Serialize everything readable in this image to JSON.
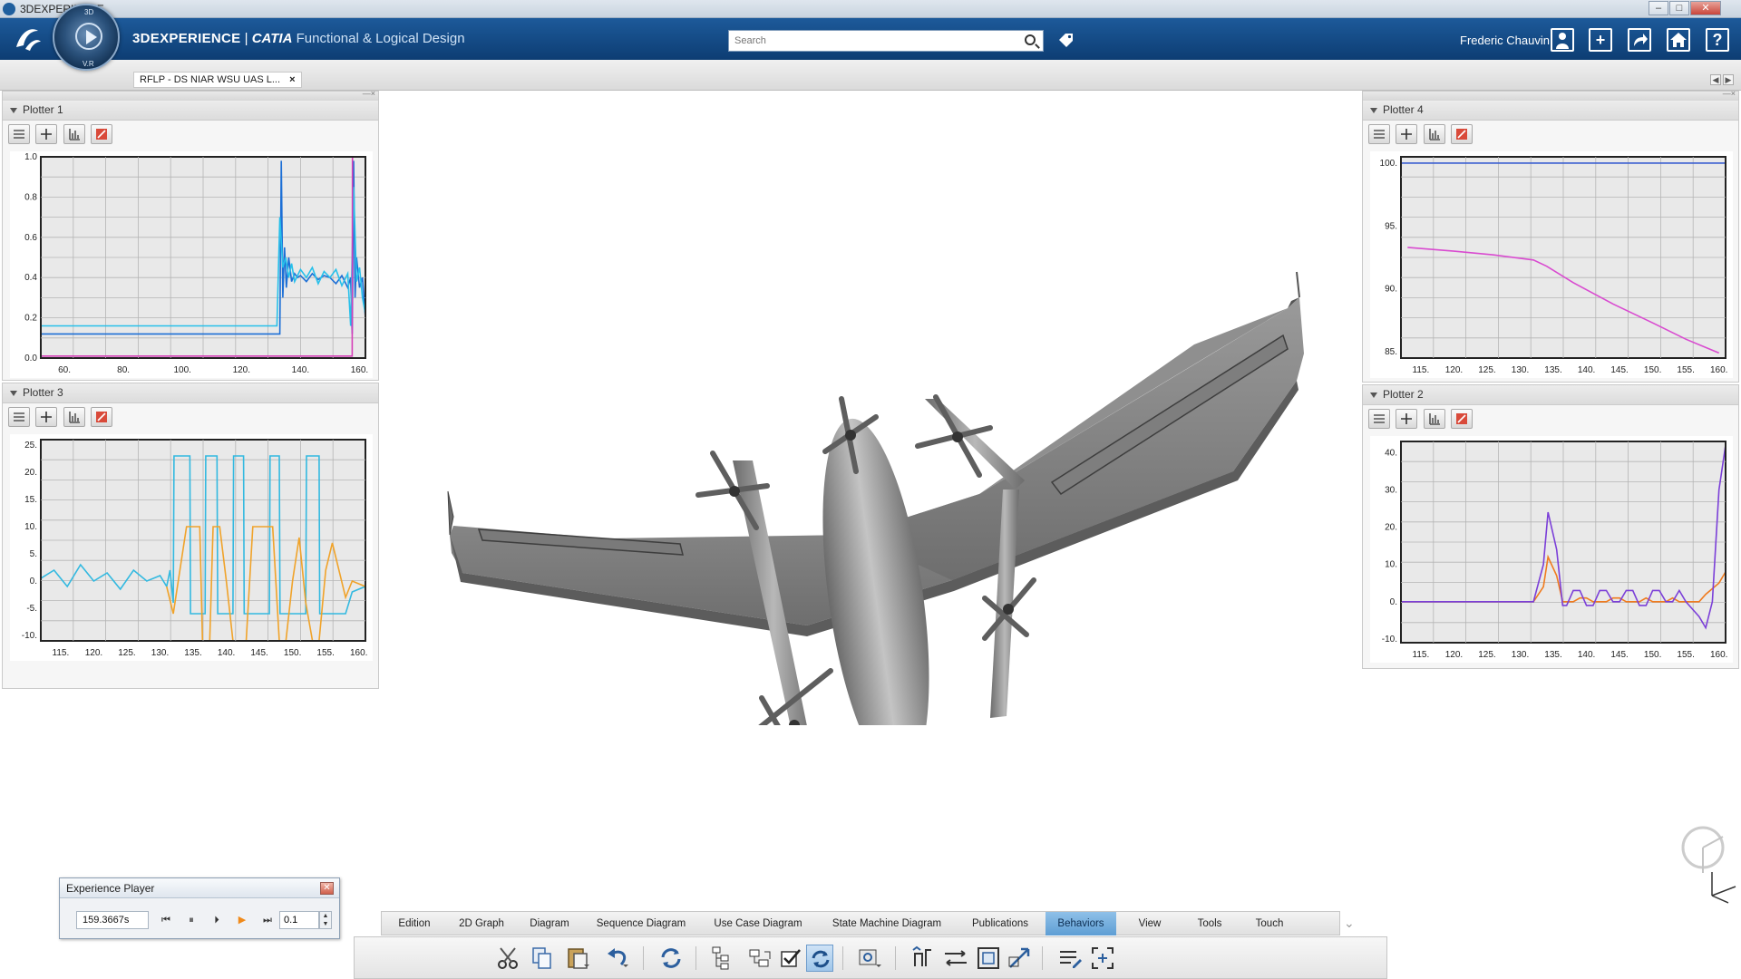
{
  "window": {
    "title": "3DEXPERIENCE"
  },
  "topbar": {
    "brand_part1": "3DEXPERIENCE",
    "brand_sep": " | ",
    "brand_part2": "CATIA",
    "brand_part3": " Functional & Logical Design",
    "search_placeholder": "Search",
    "user_name": "Frederic Chauvin",
    "compass": {
      "top_label": "3D",
      "bottom_label": "V.R"
    }
  },
  "document_tab": {
    "label": "RFLP - DS NIAR WSU UAS L...",
    "close": "×"
  },
  "plotters": {
    "p1": {
      "title": "Plotter  1",
      "chart_data": {
        "type": "line",
        "xlim": [
          52,
          162
        ],
        "ylim": [
          0,
          1.0
        ],
        "x_ticks": [
          "60.",
          "80.",
          "100.",
          "120.",
          "140.",
          "160."
        ],
        "y_ticks": [
          "1.0",
          "0.8",
          "0.6",
          "0.4",
          "0.2",
          "0.0"
        ],
        "series": [
          {
            "color": "#1c6fd6",
            "x": [
              52,
              133,
              133.5,
              134,
              134.6,
              135.2,
              136,
              137,
              138,
              139,
              140,
              142,
              144,
              146,
              148,
              150,
              152,
              154,
              156,
              157,
              157.5,
              158,
              158.5,
              159,
              160,
              161,
              162
            ],
            "y": [
              0.12,
              0.12,
              0.98,
              0.3,
              0.55,
              0.35,
              0.5,
              0.38,
              0.42,
              0.4,
              0.41,
              0.38,
              0.42,
              0.39,
              0.41,
              0.4,
              0.37,
              0.41,
              0.35,
              0.4,
              0.12,
              0.98,
              0.3,
              0.5,
              0.35,
              0.4,
              0.2
            ]
          },
          {
            "color": "#27c0ea",
            "x": [
              52,
              132,
              133,
              134,
              135,
              136,
              137,
              138,
              140,
              142,
              144,
              146,
              148,
              150,
              152,
              154,
              156,
              157,
              158,
              159,
              160,
              161,
              162
            ],
            "y": [
              0.16,
              0.16,
              0.7,
              0.45,
              0.5,
              0.4,
              0.47,
              0.38,
              0.44,
              0.4,
              0.45,
              0.37,
              0.43,
              0.4,
              0.44,
              0.36,
              0.42,
              0.16,
              0.85,
              0.38,
              0.45,
              0.3,
              0.22
            ]
          },
          {
            "color": "#d640b8",
            "x": [
              52,
              157.5,
              157.6,
              162
            ],
            "y": [
              0.01,
              0.01,
              1.0,
              1.0
            ]
          }
        ]
      }
    },
    "p3": {
      "title": "Plotter  3",
      "chart_data": {
        "type": "line",
        "xlim": [
          112,
          161
        ],
        "ylim": [
          -11,
          26
        ],
        "x_ticks": [
          "115.",
          "120.",
          "125.",
          "130.",
          "135.",
          "140.",
          "145.",
          "150.",
          "155.",
          "160."
        ],
        "y_ticks": [
          "25.",
          "20.",
          "15.",
          "10.",
          "5.",
          "0.",
          "-5.",
          "-10."
        ],
        "series": [
          {
            "color": "#33b9e0",
            "x": [
              112,
              114,
              116,
              118,
              120,
              122,
              124,
              126,
              128,
              130,
              131,
              131.5,
              132,
              132.1,
              134.5,
              134.6,
              136.8,
              136.9,
              138.6,
              138.7,
              141,
              141.1,
              142.6,
              142.7,
              146.5,
              146.6,
              148,
              148.1,
              152,
              152.1,
              154,
              154.1,
              158,
              159,
              161
            ],
            "y": [
              0.5,
              2,
              -1,
              3,
              0,
              1.5,
              -1.5,
              2,
              0,
              1,
              -1,
              2,
              -4,
              23,
              23,
              -6,
              -6,
              23,
              23,
              -6,
              -6,
              23,
              23,
              -6,
              -6,
              23,
              23,
              -6,
              -6,
              23,
              23,
              -6,
              -6,
              -2,
              -1
            ]
          },
          {
            "color": "#f0a32a",
            "x": [
              131,
              132,
              133,
              134,
              134.3,
              136,
              136.4,
              137.5,
              138,
              139,
              140,
              141,
              143,
              144,
              145,
              147,
              148,
              149,
              150,
              151,
              152,
              153,
              154,
              155,
              156,
              158,
              159,
              161
            ],
            "y": [
              -1,
              -6,
              2,
              10,
              10,
              10,
              -11,
              -11,
              10,
              10,
              0,
              -11,
              -11,
              10,
              10,
              10,
              -11,
              -11,
              0,
              8,
              -4,
              -11,
              -11,
              2,
              7,
              -3,
              0,
              -1
            ]
          }
        ]
      }
    },
    "p4": {
      "title": "Plotter  4",
      "chart_data": {
        "type": "line",
        "xlim": [
          112,
          161
        ],
        "ylim": [
          84.5,
          100.5
        ],
        "x_ticks": [
          "115.",
          "120.",
          "125.",
          "130.",
          "135.",
          "140.",
          "145.",
          "150.",
          "155.",
          "160."
        ],
        "y_ticks": [
          "100.",
          "95.",
          "90.",
          "85."
        ],
        "series": [
          {
            "color": "#3a5fd0",
            "x": [
              112,
              161
            ],
            "y": [
              100,
              100
            ]
          },
          {
            "color": "#d94bd0",
            "x": [
              113,
              120,
              126,
              132,
              134,
              138,
              144,
              150,
              155,
              160
            ],
            "y": [
              93.3,
              93,
              92.7,
              92.3,
              91.8,
              90.5,
              88.8,
              87.3,
              86,
              84.9
            ]
          }
        ]
      }
    },
    "p2": {
      "title": "Plotter  2",
      "chart_data": {
        "type": "line",
        "xlim": [
          112,
          161
        ],
        "ylim": [
          -11,
          43
        ],
        "x_ticks": [
          "115.",
          "120.",
          "125.",
          "130.",
          "135.",
          "140.",
          "145.",
          "150.",
          "155.",
          "160."
        ],
        "y_ticks": [
          "40.",
          "30.",
          "20.",
          "10.",
          "0.",
          "-10."
        ],
        "series": [
          {
            "color": "#f07b1e",
            "x": [
              112,
              132,
              133.5,
              134.2,
              135.5,
              136.4,
              137,
              138,
              139,
              140,
              141,
              142,
              143,
              144,
              145,
              146,
              147,
              148,
              149,
              150,
              151,
              152,
              153,
              154,
              155,
              156,
              157,
              158,
              160,
              161
            ],
            "y": [
              0,
              0,
              4,
              12,
              7,
              0,
              0,
              0,
              1,
              1,
              0,
              0,
              0,
              1,
              1,
              0,
              0,
              0,
              1,
              0,
              0,
              0,
              1,
              0,
              0,
              0,
              0,
              2,
              5,
              8
            ]
          },
          {
            "color": "#7b3fd8",
            "x": [
              112,
              132,
              133.5,
              134.2,
              135.5,
              136.4,
              137,
              138,
              139,
              140,
              141,
              142,
              143,
              144,
              145,
              146,
              147,
              148,
              149,
              150,
              151,
              152,
              153,
              154,
              155,
              156,
              157,
              158,
              159,
              160,
              161
            ],
            "y": [
              0,
              0,
              10,
              24,
              14,
              -1,
              -1,
              3,
              3,
              -1,
              -1,
              3,
              3,
              0,
              0,
              3,
              3,
              -1,
              -1,
              3,
              3,
              0,
              0,
              3,
              0,
              -2,
              -4,
              -7,
              0,
              30,
              42
            ]
          }
        ]
      }
    }
  },
  "player": {
    "title": "Experience Player",
    "time": "159.3667s",
    "step": "0.1",
    "buttons": {
      "first": "⏮",
      "pause": "⏸",
      "step": "⏵",
      "play": "▶",
      "last": "⏭"
    }
  },
  "actionbar": {
    "tabs": [
      "Edition",
      "2D Graph",
      "Diagram",
      "Sequence Diagram",
      "Use Case Diagram",
      "State Machine Diagram",
      "Publications",
      "Behaviors",
      "View",
      "Tools",
      "Touch"
    ],
    "active": "Behaviors"
  },
  "colors": {
    "brand_bar": "#0d3d73",
    "active_tab": "#5e9ed4",
    "model_gray": "#7f7f7f"
  }
}
